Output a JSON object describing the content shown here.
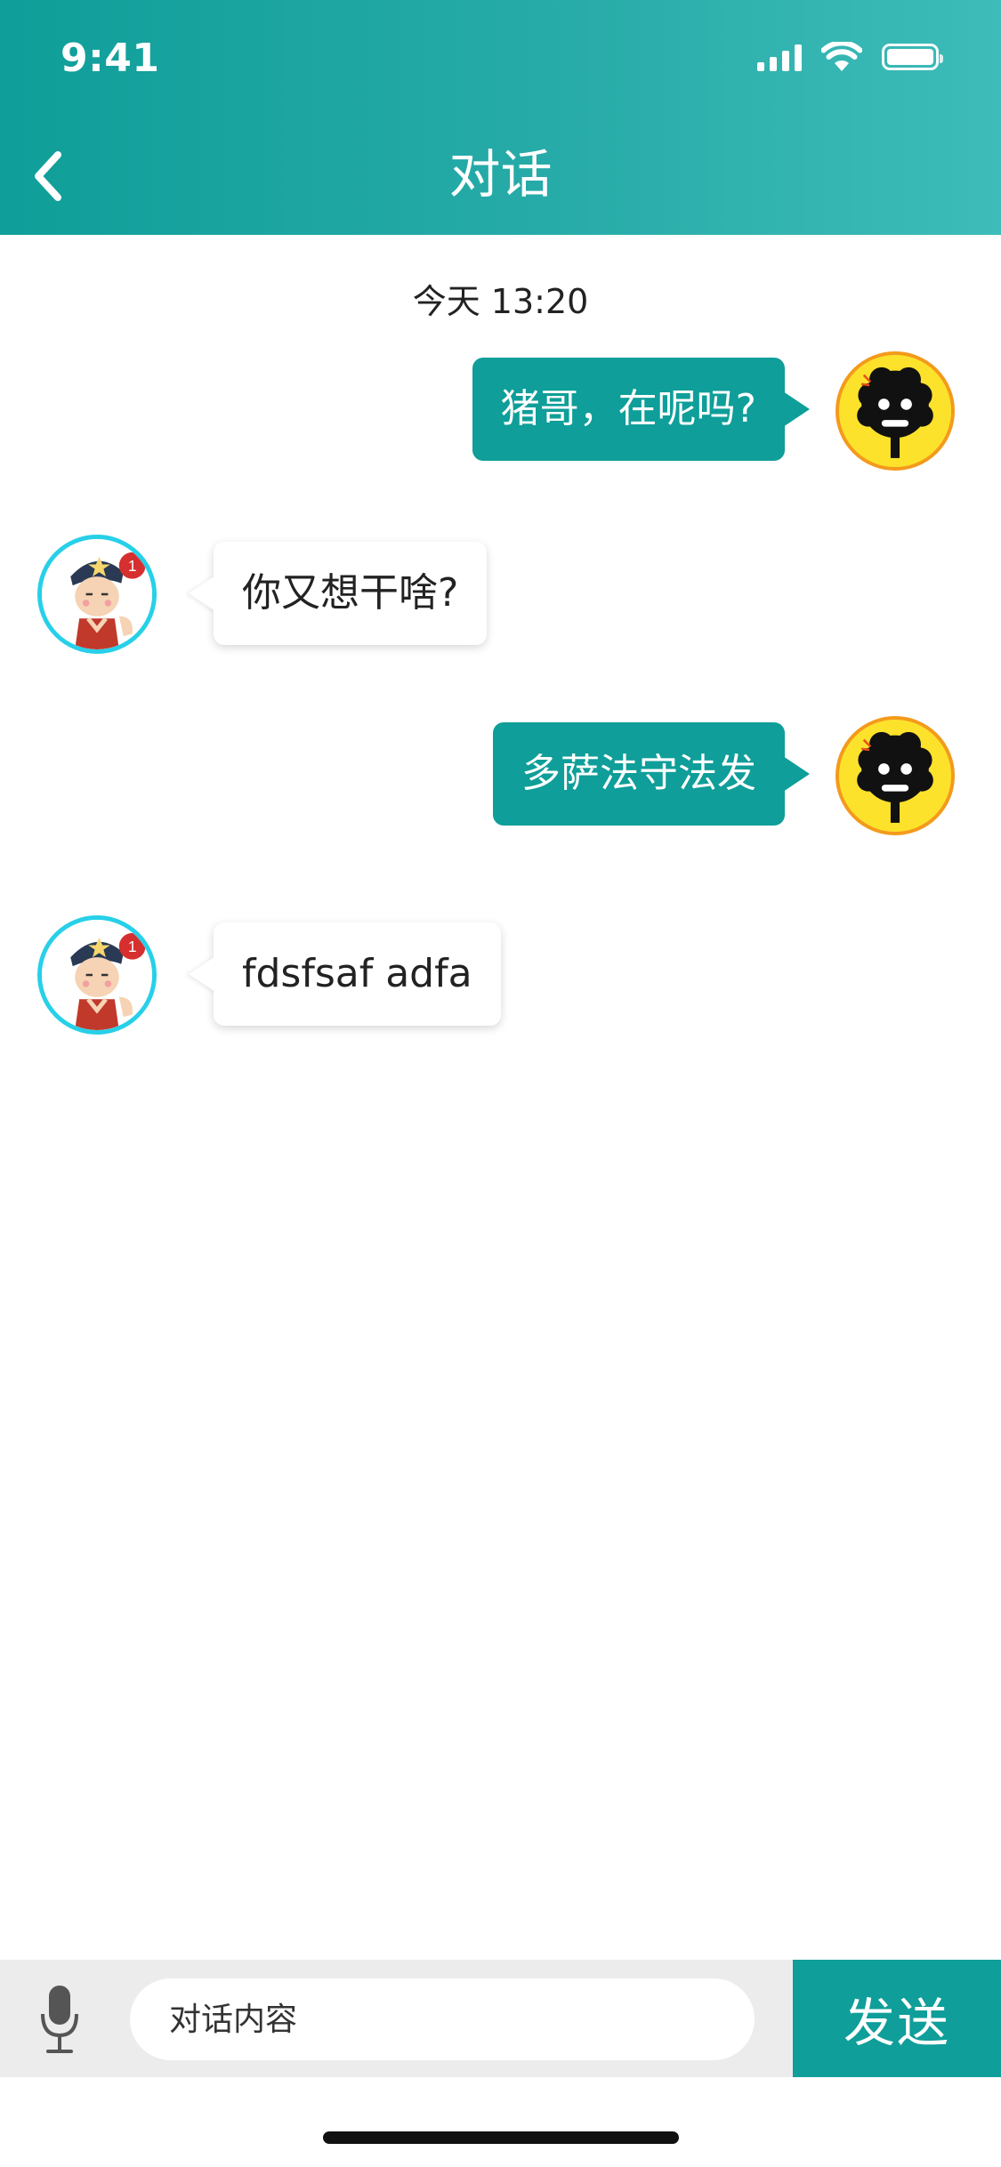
{
  "status_bar": {
    "time": "9:41"
  },
  "header": {
    "title": "对话"
  },
  "chat": {
    "timestamp": "今天 13:20",
    "messages": [
      {
        "sender": "me",
        "text": "猪哥，在呢吗?"
      },
      {
        "sender": "friend",
        "text": "你又想干啥?"
      },
      {
        "sender": "me",
        "text": "多萨法守法发"
      },
      {
        "sender": "friend",
        "text": "fdsfsaf adfa"
      }
    ]
  },
  "input_bar": {
    "placeholder": "对话内容",
    "value": "",
    "send_label": "发送"
  },
  "colors": {
    "accent": "#0f9e99",
    "header_gradient_end": "#3dbcb9",
    "friend_avatar_ring": "#27d0e8",
    "my_avatar_ring": "#f39a1c"
  },
  "icons": {
    "back": "chevron-left-icon",
    "microphone": "microphone-icon",
    "signal": "cellular-signal-icon",
    "wifi": "wifi-icon",
    "battery": "battery-icon"
  }
}
